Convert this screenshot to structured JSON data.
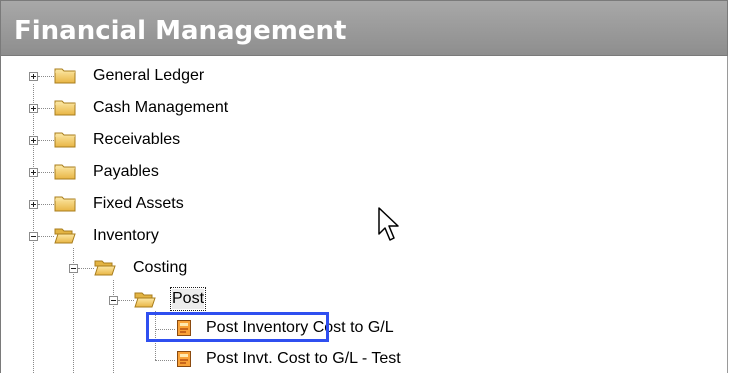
{
  "header": {
    "title": "Financial Management"
  },
  "tree": {
    "general_ledger": "General Ledger",
    "cash_management": "Cash Management",
    "receivables": "Receivables",
    "payables": "Payables",
    "fixed_assets": "Fixed Assets",
    "inventory": "Inventory",
    "costing": "Costing",
    "post": "Post",
    "post_inventory_cost": "Post Inventory Cost to G/L",
    "post_invt_cost_test": "Post Invt. Cost to G/L - Test"
  },
  "colors": {
    "header_bg": "#9b9b9b",
    "highlight_border": "#2f4ff0",
    "folder": "#f3cf6a"
  },
  "icons": [
    "expand-icon",
    "collapse-icon",
    "folder-icon",
    "open-folder-icon",
    "report-icon",
    "mouse-cursor-icon"
  ]
}
